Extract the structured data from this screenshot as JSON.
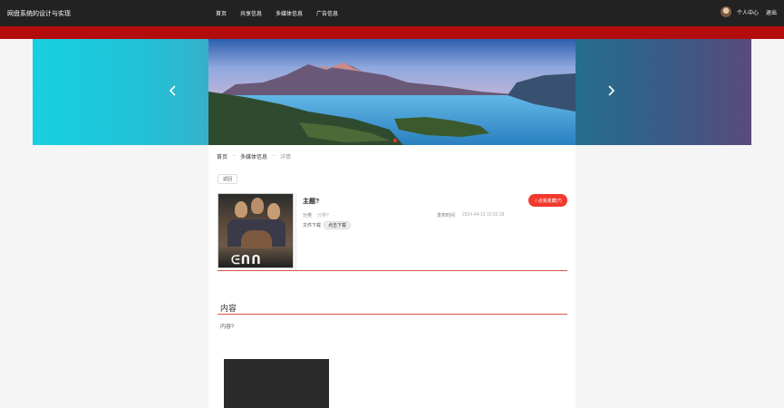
{
  "header": {
    "brand": "网盘系统的设计与实现",
    "nav": [
      "首页",
      "共享信息",
      "多媒体信息",
      "广告信息"
    ],
    "user_center": "个人中心",
    "logout": "退出"
  },
  "banner": {
    "prev_icon": "chevron-left-icon",
    "next_icon": "chevron-right-icon"
  },
  "breadcrumb": {
    "home": "首页",
    "category": "多媒体信息",
    "current": "详情",
    "separator": "→"
  },
  "detail": {
    "back_label": "返回",
    "title": "主题?",
    "collect_label": "☆点我收藏(?)",
    "category_label": "分类",
    "category_value": "分类?",
    "publish_label": "发布时间",
    "publish_value": "2024-04-12 22:32:18",
    "file_label": "文件下载",
    "download_label": "点击下载"
  },
  "content_section": {
    "title": "内容",
    "text": "内容?"
  },
  "colors": {
    "topbar": "#222222",
    "accent_red": "#b30c0c",
    "button_red": "#f2392d"
  }
}
